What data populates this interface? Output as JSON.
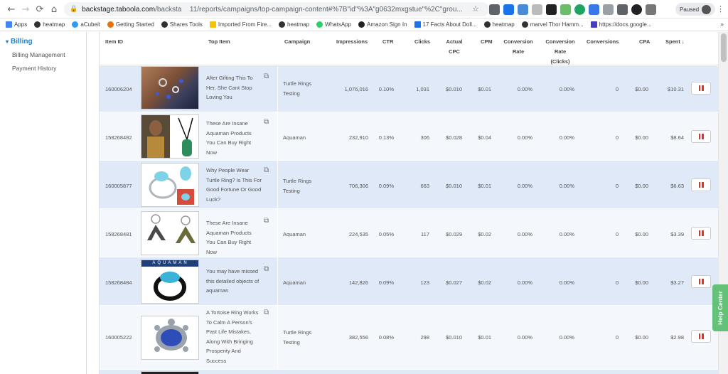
{
  "browser": {
    "url_host": "backstage.taboola.com",
    "url_path_a": "/backsta",
    "url_path_b": "11/reports/campaigns/top-campaign-content#%7B\"id\"%3A\"g0632mxgstue\"%2C\"grou...",
    "paused_label": "Paused",
    "bookmarks": [
      "Apps",
      "heatmap",
      "aCubeit",
      "Getting Started",
      "Shares Tools",
      "Imported From Fire...",
      "heatmap",
      "WhatsApp",
      "Amazon Sign In",
      "17 Facts About Doll...",
      "heatmap",
      "marvel Thor Hamm...",
      "https://docs.google..."
    ],
    "bookmarks_more": "»"
  },
  "sidebar": {
    "heading": "Billing",
    "items": [
      "Billing Management",
      "Payment History"
    ]
  },
  "table": {
    "headers": {
      "item_id": "Item ID",
      "top_item": "Top Item",
      "campaign": "Campaign",
      "impressions": "Impressions",
      "ctr": "CTR",
      "clicks": "Clicks",
      "actual_cpc_1": "Actual",
      "actual_cpc_2": "CPC",
      "cpm": "CPM",
      "conv_rate_1": "Conversion",
      "conv_rate_2": "Rate",
      "conv_rate_clicks_1": "Conversion",
      "conv_rate_clicks_2": "Rate",
      "conv_rate_clicks_3": "(Clicks)",
      "conversions": "Conversions",
      "cpa": "CPA",
      "spent": "Spent ↓"
    },
    "rows": [
      {
        "id": "160006204",
        "title": "After Gifting This To Her, She Cant Stop Loving You",
        "campaign": "Turtle Rings Testing",
        "impressions": "1,076,016",
        "ctr": "0.10%",
        "clicks": "1,031",
        "cpc": "$0.010",
        "cpm": "$0.01",
        "conv_rate": "0.00%",
        "conv_rate_clicks": "0.00%",
        "conversions": "0",
        "cpa": "$0.00",
        "spent": "$10.31"
      },
      {
        "id": "158268482",
        "title": "These Are Insane Aquaman Products You Can Buy Right Now",
        "campaign": "Aquaman",
        "impressions": "232,910",
        "ctr": "0.13%",
        "clicks": "306",
        "cpc": "$0.028",
        "cpm": "$0.04",
        "conv_rate": "0.00%",
        "conv_rate_clicks": "0.00%",
        "conversions": "0",
        "cpa": "$0.00",
        "spent": "$8.64"
      },
      {
        "id": "160005877",
        "title": "Why People Wear Turtle Ring? Is This For Good Fortune Or Good Luck?",
        "campaign": "Turtle Rings Testing",
        "impressions": "706,306",
        "ctr": "0.09%",
        "clicks": "663",
        "cpc": "$0.010",
        "cpm": "$0.01",
        "conv_rate": "0.00%",
        "conv_rate_clicks": "0.00%",
        "conversions": "0",
        "cpa": "$0.00",
        "spent": "$6.63"
      },
      {
        "id": "158268481",
        "title": "These Are Insane Aquaman Products You Can Buy Right Now",
        "campaign": "Aquaman",
        "impressions": "224,535",
        "ctr": "0.05%",
        "clicks": "117",
        "cpc": "$0.029",
        "cpm": "$0.02",
        "conv_rate": "0.00%",
        "conv_rate_clicks": "0.00%",
        "conversions": "0",
        "cpa": "$0.00",
        "spent": "$3.39"
      },
      {
        "id": "158268484",
        "title": "You may have missed this detailed objects of aquaman",
        "campaign": "Aquaman",
        "impressions": "142,826",
        "ctr": "0.09%",
        "clicks": "123",
        "cpc": "$0.027",
        "cpm": "$0.02",
        "conv_rate": "0.00%",
        "conv_rate_clicks": "0.00%",
        "conversions": "0",
        "cpa": "$0.00",
        "spent": "$3.27"
      },
      {
        "id": "160005222",
        "title": "A Tortoise Ring Works To Calm A Person's Past Life Mistakes, Along With Bringing Prosperity And Success",
        "campaign": "Turtle Rings Testing",
        "impressions": "382,556",
        "ctr": "0.08%",
        "clicks": "298",
        "cpc": "$0.010",
        "cpm": "$0.01",
        "conv_rate": "0.00%",
        "conv_rate_clicks": "0.00%",
        "conversions": "0",
        "cpa": "$0.00",
        "spent": "$2.98"
      }
    ],
    "thumb_overlay_text": "AQUAMAN"
  },
  "help_label": "Help Center",
  "colors": {
    "row_alt": "#dfe9f7",
    "row_plain": "#f4f7fb",
    "pause_red": "#e0322d",
    "help_green": "#63c178",
    "sidebar_blue": "#2b7fc1"
  }
}
